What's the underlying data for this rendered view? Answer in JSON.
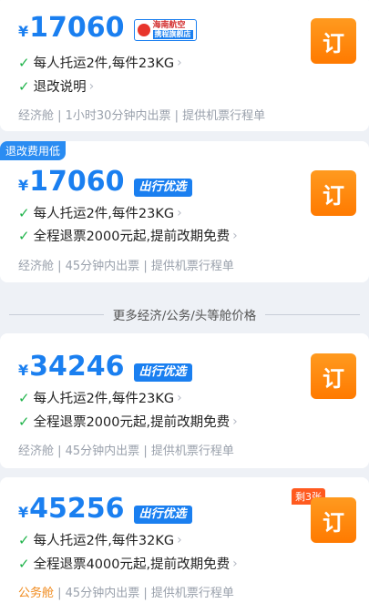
{
  "cards": [
    {
      "price": "17060",
      "currency": "¥",
      "airline": {
        "name": "海南航空",
        "sub": "携程旗舰店"
      },
      "baggage": "每人托运2件,每件23KG",
      "refund": "退改说明",
      "meta": "经济舱 | 1小时30分钟内出票 | 提供机票行程单",
      "book": "订"
    },
    {
      "tag": "退改费用低",
      "price": "17060",
      "currency": "¥",
      "badge": "出行优选",
      "baggage": "每人托运2件,每件23KG",
      "refund": "全程退票2000元起,提前改期免费",
      "meta": "经济舱 | 45分钟内出票 | 提供机票行程单",
      "book": "订"
    },
    {
      "price": "34246",
      "currency": "¥",
      "badge": "出行优选",
      "baggage": "每人托运2件,每件23KG",
      "refund": "全程退票2000元起,提前改期免费",
      "meta": "经济舱 | 45分钟内出票 | 提供机票行程单",
      "book": "订"
    },
    {
      "price": "45256",
      "currency": "¥",
      "badge": "出行优选",
      "remaining": "剩3张",
      "baggage": "每人托运2件,每件32KG",
      "refund": "全程退票4000元起,提前改期免费",
      "cabin": "公务舱",
      "meta_rest": " | 45分钟内出票 | 提供机票行程单",
      "book": "订"
    }
  ],
  "divider": "更多经济/公务/头等舱价格",
  "colors": {
    "price": "#1a7ff0",
    "book": "#ff8a00",
    "check": "#1fb34a",
    "cabin_business": "#f08a1c"
  }
}
